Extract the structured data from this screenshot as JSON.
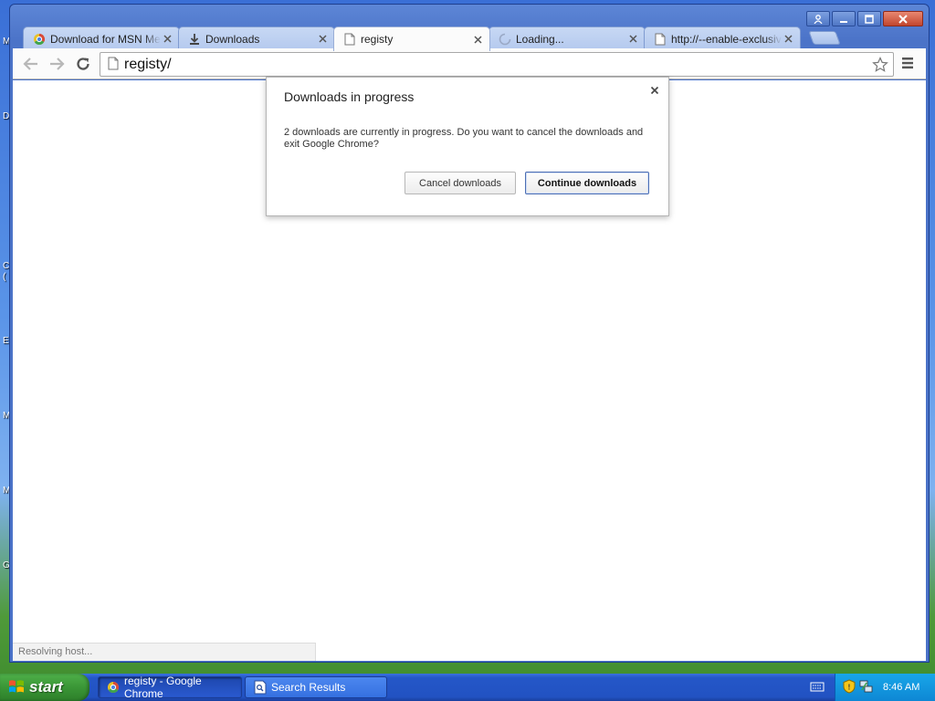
{
  "desktop": {
    "stubs": [
      "M",
      "D",
      "C",
      "(",
      "E",
      "M",
      "M",
      "G"
    ]
  },
  "window": {
    "controls": [
      "profile-icon",
      "minimize-icon",
      "maximize-icon",
      "close-icon"
    ]
  },
  "tabs": [
    {
      "title": "Download for MSN Messenger",
      "favicon": "msn-icon",
      "active": false
    },
    {
      "title": "Downloads",
      "favicon": "download-icon",
      "active": false
    },
    {
      "title": "registy",
      "favicon": "page-icon",
      "active": true
    },
    {
      "title": "Loading...",
      "favicon": "loading-icon",
      "active": false
    },
    {
      "title": "http://--enable-exclusive",
      "favicon": "page-icon",
      "active": false
    }
  ],
  "toolbar": {
    "url": "registy/"
  },
  "dialog": {
    "title": "Downloads in progress",
    "message": "2 downloads are currently in progress. Do you want to cancel the downloads and exit Google Chrome?",
    "cancel_label": "Cancel downloads",
    "continue_label": "Continue downloads"
  },
  "status": {
    "text": "Resolving host..."
  },
  "taskbar": {
    "start_label": "start",
    "tasks": [
      {
        "label": "registy - Google Chrome",
        "icon": "chrome-icon",
        "active": true
      },
      {
        "label": "Search Results",
        "icon": "search-results-icon",
        "active": false
      }
    ],
    "clock": "8:46 AM"
  },
  "colors": {
    "taskbar_blue": "#2457c8",
    "start_green": "#3a9636",
    "tab_inactive": "#c7d8f4",
    "dialog_primary_border": "#4d6fb3"
  }
}
